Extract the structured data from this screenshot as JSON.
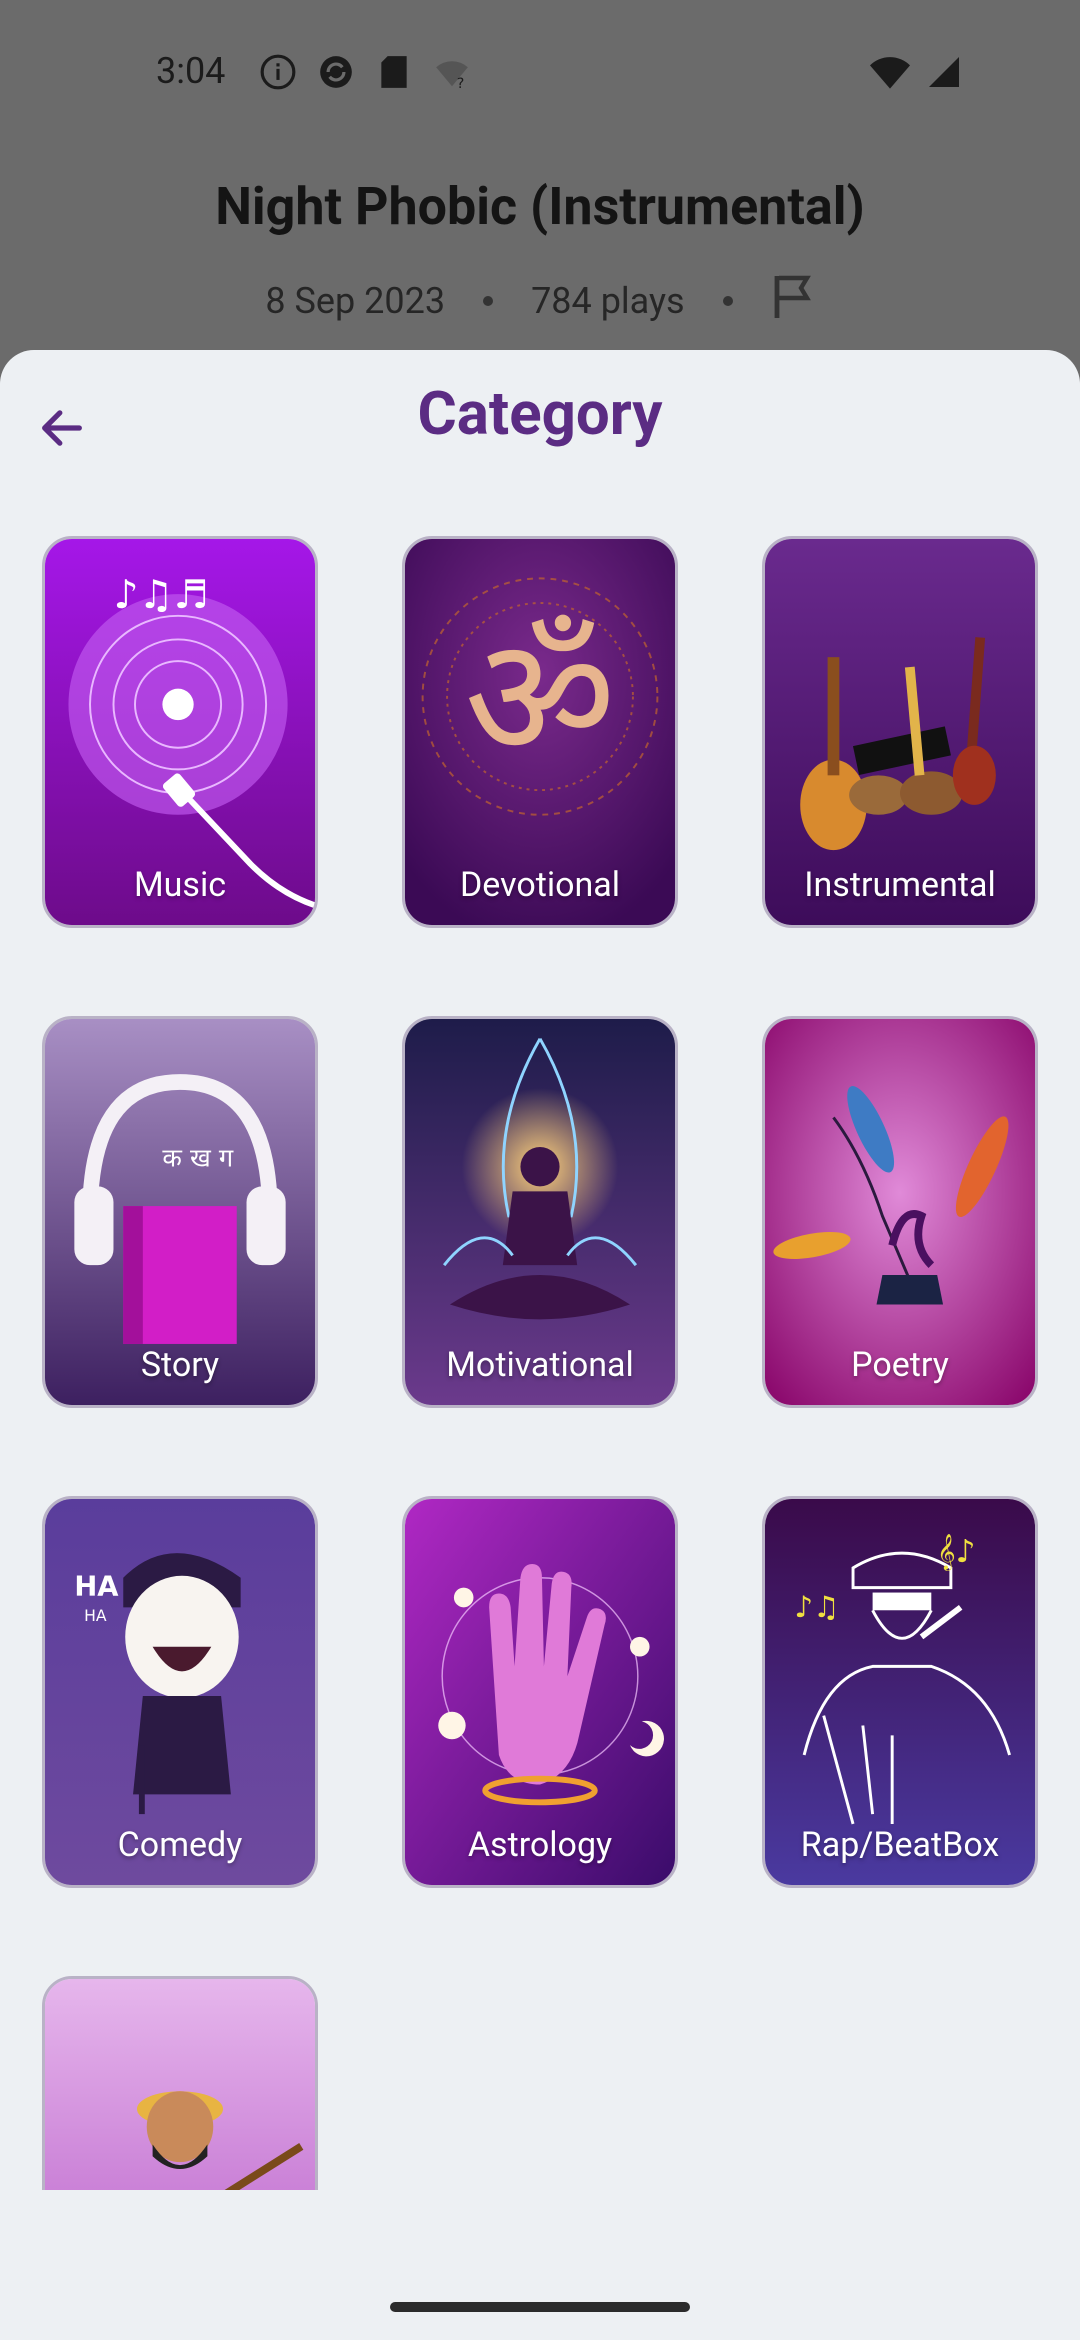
{
  "status_bar": {
    "time": "3:04"
  },
  "background": {
    "title": "Night Phobic (Instrumental)",
    "date": "8 Sep 2023",
    "plays": "784 plays"
  },
  "sheet": {
    "title": "Category",
    "categories": [
      {
        "label": "Music"
      },
      {
        "label": "Devotional"
      },
      {
        "label": "Instrumental"
      },
      {
        "label": "Story"
      },
      {
        "label": "Motivational"
      },
      {
        "label": "Poetry"
      },
      {
        "label": "Comedy"
      },
      {
        "label": "Astrology"
      },
      {
        "label": "Rap/BeatBox"
      },
      {
        "label": ""
      }
    ]
  },
  "colors": {
    "accent": "#5b2c83",
    "sheet_bg": "#edf0f3"
  }
}
